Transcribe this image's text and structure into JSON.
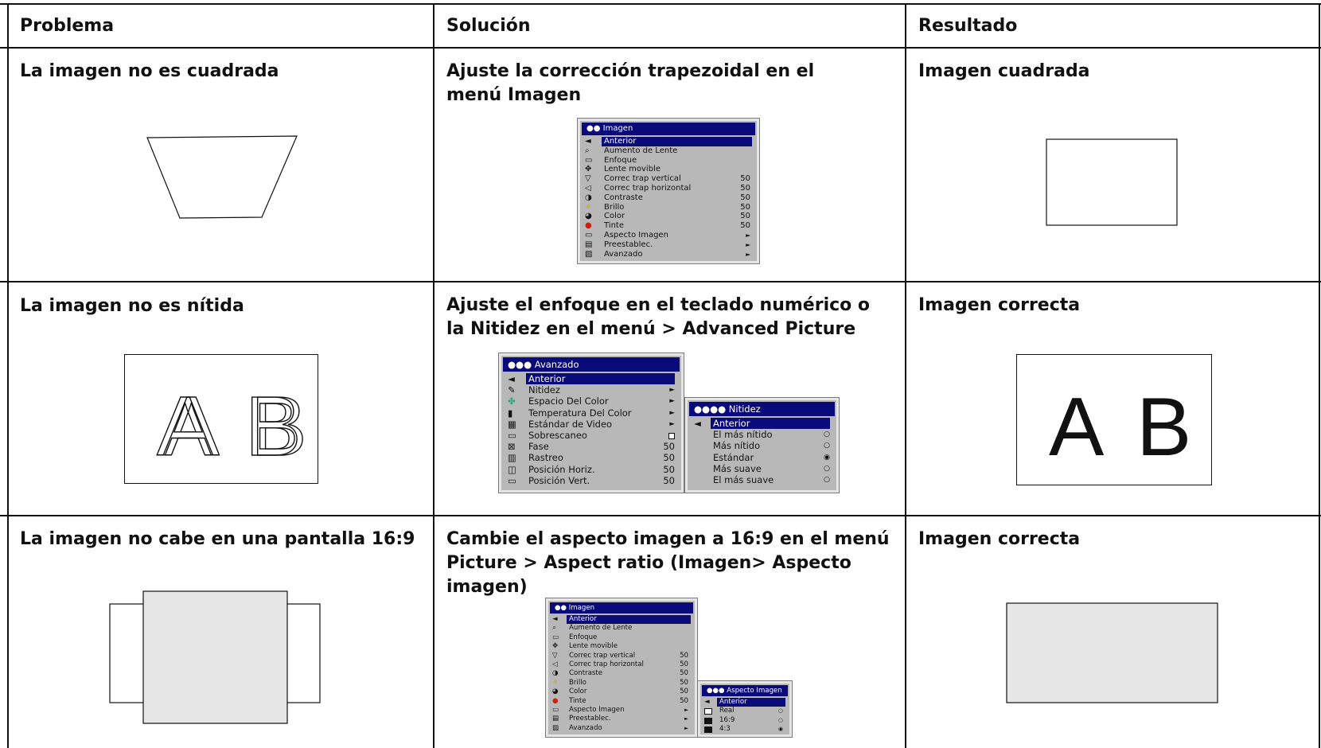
{
  "table": {
    "headers": [
      "Problema",
      "Solución",
      "Resultado"
    ],
    "rows": [
      {
        "problem": "La imagen no es cuadrada",
        "solution": "Ajuste la corrección trapezoidal en el menú Imagen",
        "result": "Imagen cuadrada"
      },
      {
        "problem": "La imagen no es nítida",
        "solution": "Ajuste el enfoque en el teclado numérico o la Nitidez en el menú > Advanced Picture",
        "result": "Imagen correcta"
      },
      {
        "problem": "La imagen no cabe en una pantalla 16:9",
        "solution": "Cambie el aspecto imagen a 16:9 en el menú Picture > Aspect ratio (Imagen> Aspecto imagen)",
        "result": "Imagen correcta"
      }
    ]
  },
  "letters": {
    "a": "A",
    "b": "B"
  },
  "menu_imagen": {
    "title": "Imagen",
    "items": [
      {
        "label": "Anterior",
        "icon": "back-arrow-icon",
        "value": ""
      },
      {
        "label": "Aumento de Lente",
        "icon": "zoom-icon",
        "value": ""
      },
      {
        "label": "Enfoque",
        "icon": "focus-icon",
        "value": ""
      },
      {
        "label": "Lente movible",
        "icon": "lens-shift-icon",
        "value": ""
      },
      {
        "label": "Correc trap vertical",
        "icon": "keystone-vertical-icon",
        "value": "50"
      },
      {
        "label": "Correc trap horizontal",
        "icon": "keystone-horizontal-icon",
        "value": "50"
      },
      {
        "label": "Contraste",
        "icon": "contrast-icon",
        "value": "50"
      },
      {
        "label": "Brillo",
        "icon": "brightness-icon",
        "value": "50"
      },
      {
        "label": "Color",
        "icon": "color-icon",
        "value": "50"
      },
      {
        "label": "Tinte",
        "icon": "tint-icon",
        "value": "50"
      },
      {
        "label": "Aspecto Imagen",
        "icon": "aspect-icon",
        "value": "►"
      },
      {
        "label": "Preestablec.",
        "icon": "presets-icon",
        "value": "►"
      },
      {
        "label": "Avanzado",
        "icon": "advanced-icon",
        "value": "►"
      }
    ]
  },
  "menu_avanzado": {
    "title": "Avanzado",
    "items": [
      {
        "label": "Anterior",
        "icon": "back-arrow-icon",
        "value": ""
      },
      {
        "label": "Nitidez",
        "icon": "sharpness-icon",
        "value": "►"
      },
      {
        "label": "Espacio Del Color",
        "icon": "color-space-icon",
        "value": "►"
      },
      {
        "label": "Temperatura Del Color",
        "icon": "thermometer-icon",
        "value": "►"
      },
      {
        "label": "Estándar de Video",
        "icon": "video-standard-icon",
        "value": "►"
      },
      {
        "label": "Sobrescaneo",
        "icon": "overscan-icon",
        "value": ""
      },
      {
        "label": "Fase",
        "icon": "phase-icon",
        "value": "50"
      },
      {
        "label": "Rastreo",
        "icon": "tracking-icon",
        "value": "50"
      },
      {
        "label": "Posición Horiz.",
        "icon": "horizontal-position-icon",
        "value": "50"
      },
      {
        "label": "Posición Vert.",
        "icon": "vertical-position-icon",
        "value": "50"
      }
    ]
  },
  "menu_nitidez": {
    "title": "Nitidez",
    "items": [
      {
        "label": "Anterior",
        "selected": false
      },
      {
        "label": "El más nítido",
        "selected": false
      },
      {
        "label": "Más nítido",
        "selected": false
      },
      {
        "label": "Estándar",
        "selected": true
      },
      {
        "label": "Más suave",
        "selected": false
      },
      {
        "label": "El más suave",
        "selected": false
      }
    ]
  },
  "menu_aspecto": {
    "title": "Aspecto Imagen",
    "items": [
      {
        "label": "Anterior",
        "selected": false
      },
      {
        "label": "Real",
        "selected": false
      },
      {
        "label": "16:9",
        "selected": false
      },
      {
        "label": "4:3",
        "selected": true
      }
    ]
  },
  "colors": {
    "osd_bar": "#0a0a7a",
    "osd_bg": "#b8b8b8",
    "line": "#111111",
    "fill_gray": "#e6e6e6"
  }
}
